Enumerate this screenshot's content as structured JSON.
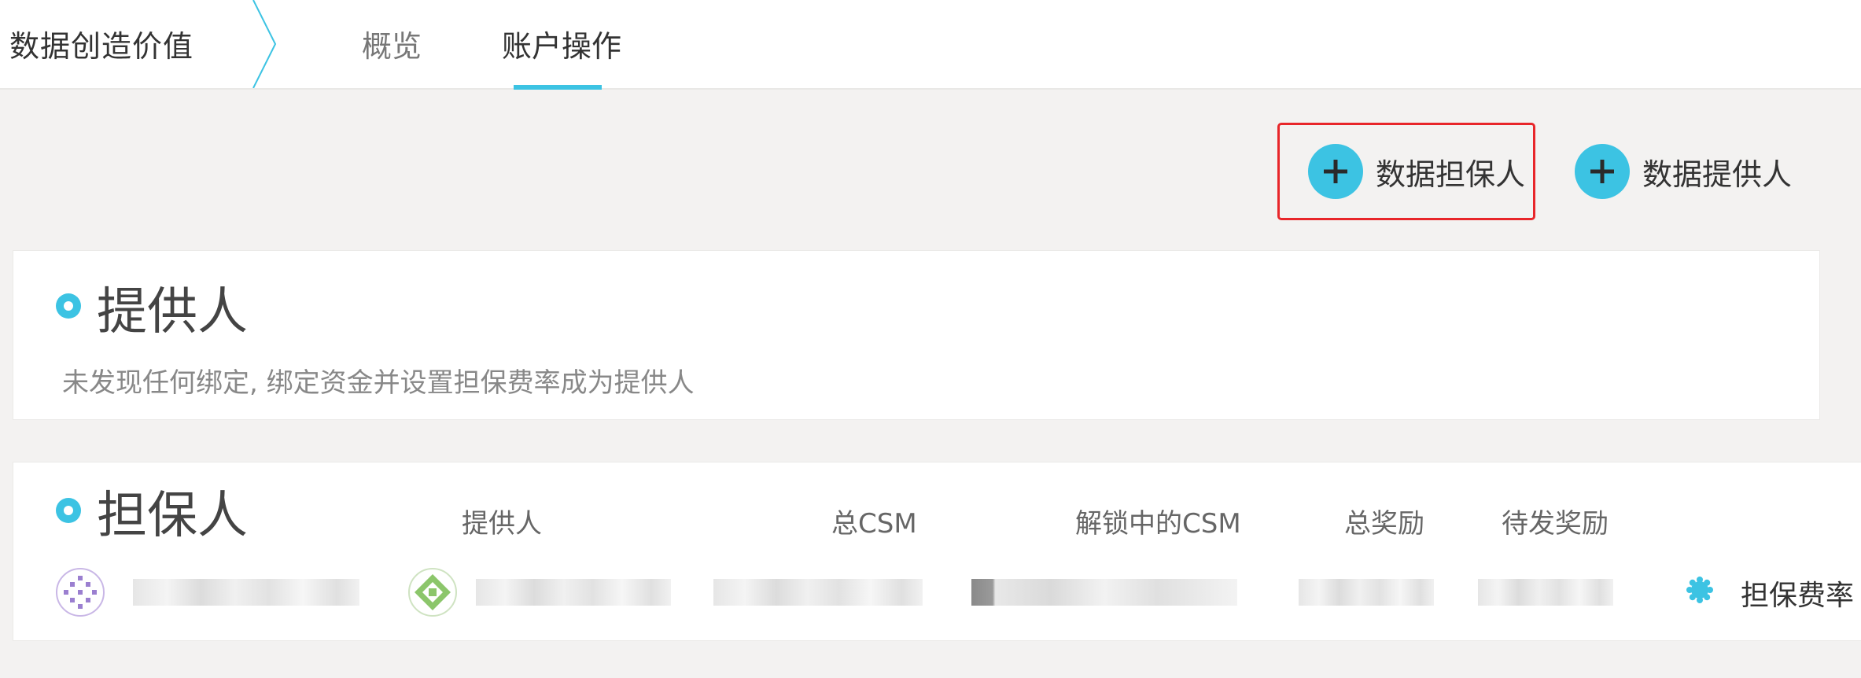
{
  "header": {
    "brand": "数据创造价值",
    "tabs": [
      {
        "label": "概览",
        "active": false
      },
      {
        "label": "账户操作",
        "active": true
      }
    ]
  },
  "actions": {
    "add_guarantor": "数据担保人",
    "add_provider": "数据提供人"
  },
  "provider_section": {
    "title": "提供人",
    "empty_message": "未发现任何绑定, 绑定资金并设置担保费率成为提供人"
  },
  "guarantor_section": {
    "title": "担保人",
    "columns": [
      "提供人",
      "总CSM",
      "解锁中的CSM",
      "总奖励",
      "待发奖励"
    ],
    "rate_label": "担保费率"
  },
  "colors": {
    "accent": "#3cc3e3",
    "highlight_border": "#e8262a"
  }
}
